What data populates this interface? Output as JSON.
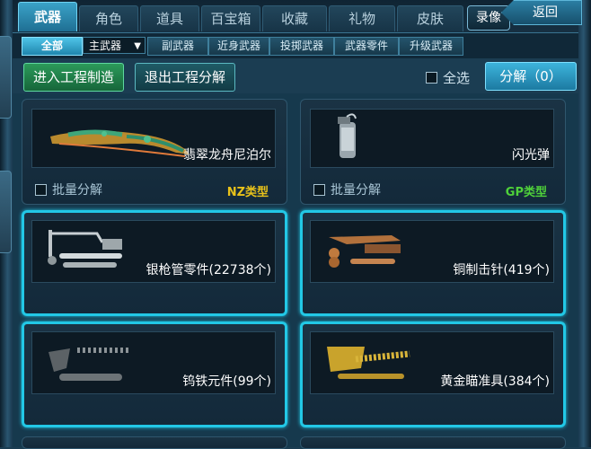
{
  "tabs": [
    {
      "label": "武器",
      "active": true
    },
    {
      "label": "角色",
      "active": false
    },
    {
      "label": "道具",
      "active": false
    },
    {
      "label": "百宝箱",
      "active": false
    },
    {
      "label": "收藏",
      "active": false
    },
    {
      "label": "礼物",
      "active": false
    },
    {
      "label": "皮肤",
      "active": false
    }
  ],
  "header": {
    "record_label": "录像",
    "back_label": "返回"
  },
  "subtabs": {
    "all": "全部",
    "primary_select": "主武器",
    "items": [
      "副武器",
      "近身武器",
      "投掷武器",
      "武器零件",
      "升级武器"
    ]
  },
  "actions": {
    "enter_craft": "进入工程制造",
    "exit_decompose": "退出工程分解",
    "select_all": "全选",
    "decompose": "分解（0）"
  },
  "colors": {
    "accent": "#22c8e6",
    "nz_type": "#e8c21a",
    "gp_type": "#4fd13a"
  },
  "items": [
    {
      "name": "翡翠龙舟尼泊尔",
      "batch_label": "批量分解",
      "type": "NZ类型",
      "selected": false,
      "icon": "jade-dragon-knife-icon"
    },
    {
      "name": "闪光弹",
      "batch_label": "批量分解",
      "type": "GP类型",
      "selected": false,
      "icon": "flashbang-icon"
    },
    {
      "name": "银枪管零件(22738个)",
      "selected": true,
      "icon": "silver-barrel-part-icon"
    },
    {
      "name": "铜制击针(419个)",
      "selected": true,
      "icon": "copper-firing-pin-icon"
    },
    {
      "name": "钨铁元件(99个)",
      "selected": true,
      "icon": "tungsten-component-icon"
    },
    {
      "name": "黄金瞄准具(384个)",
      "selected": true,
      "icon": "gold-sight-icon"
    }
  ]
}
